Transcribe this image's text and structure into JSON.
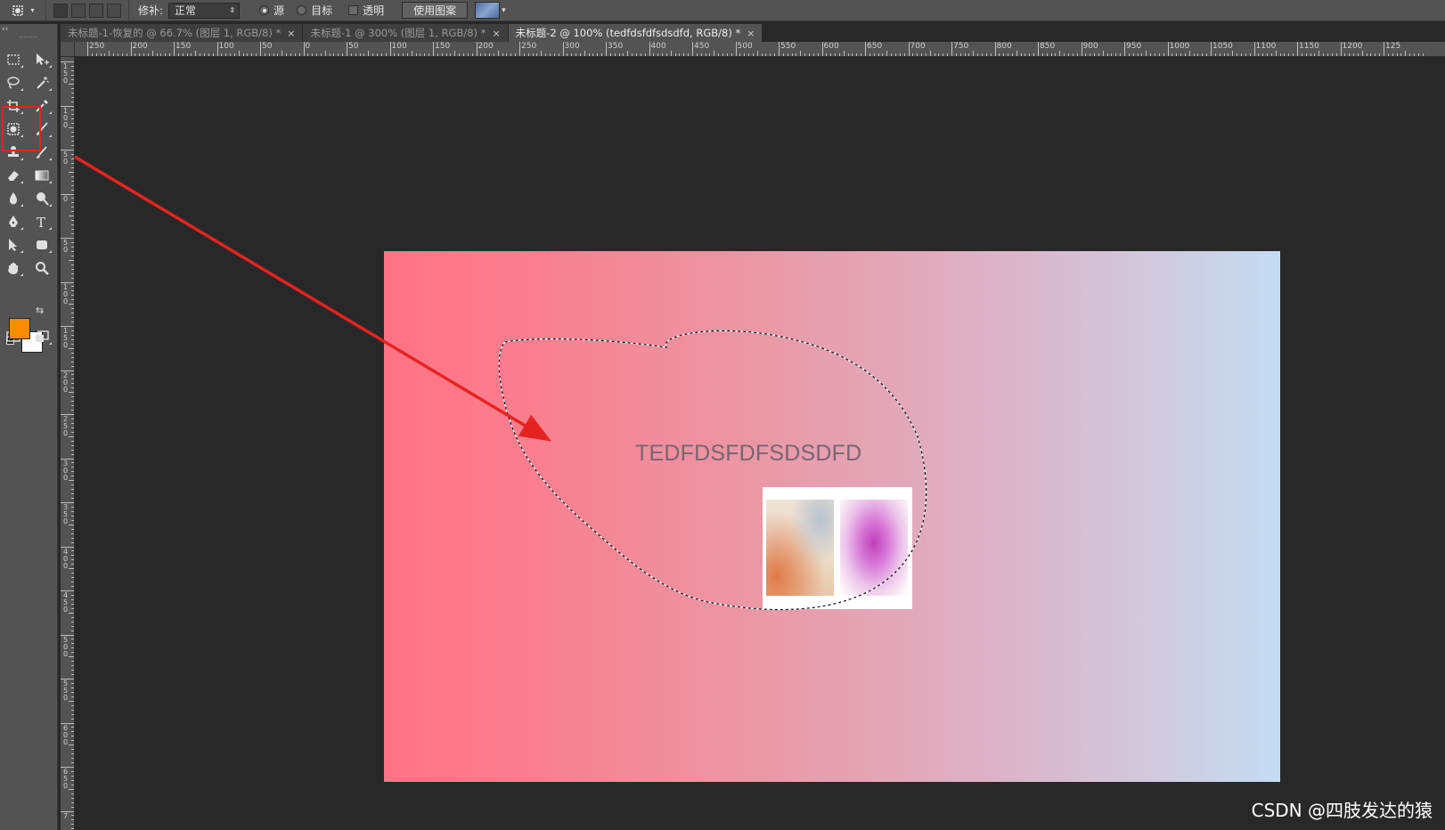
{
  "options_bar": {
    "tool_icon": "patch-tool-icon",
    "patch_label": "修补:",
    "patch_mode": "正常",
    "source_label": "源",
    "target_label": "目标",
    "transparent_label": "透明",
    "use_pattern_label": "使用图案",
    "source_selected": true,
    "transparent_checked": false
  },
  "tabs": [
    {
      "label": "未标题-1-恢复的 @ 66.7% (图层 1, RGB/8) *",
      "close": "×",
      "active": false
    },
    {
      "label": "未标题-1 @ 300% (图层 1, RGB/8) *",
      "close": "×",
      "active": false
    },
    {
      "label": "未标题-2 @ 100% (tedfdsfdfsdsdfd, RGB/8) *",
      "close": "×",
      "active": true
    }
  ],
  "toolbar": {
    "collapse_glyph": "‹‹",
    "tools": [
      "rectangular-marquee-tool",
      "move-tool",
      "lasso-tool",
      "magic-wand-tool",
      "crop-tool",
      "eyedropper-tool",
      "patch-tool",
      "brush-tool",
      "clone-stamp-tool",
      "history-brush-tool",
      "eraser-tool",
      "gradient-tool",
      "blur-tool",
      "dodge-tool",
      "pen-tool",
      "type-tool",
      "path-selection-tool",
      "rectangle-tool",
      "hand-tool",
      "zoom-tool",
      "quick-mask-icon",
      "screen-mode-icon"
    ],
    "foreground_color": "#ff8c00",
    "background_color": "#ffffff",
    "highlighted_tool": "patch-tool"
  },
  "ruler_top": [
    "250",
    "200",
    "150",
    "100",
    "50",
    "0",
    "50",
    "100",
    "150",
    "200",
    "250",
    "300",
    "350",
    "400",
    "450",
    "500",
    "550",
    "600",
    "650",
    "700",
    "750",
    "800",
    "850",
    "900",
    "950",
    "1000",
    "1050",
    "1100",
    "1150",
    "1200",
    "125"
  ],
  "ruler_left": [
    "150",
    "100",
    "50",
    "0",
    "50",
    "100",
    "150",
    "200",
    "250",
    "300",
    "350",
    "400",
    "450",
    "500",
    "550",
    "600",
    "650",
    "7"
  ],
  "document": {
    "text_layer": "TEDFDSFDFSDSDFD",
    "gradient_start": "#ff7285",
    "gradient_end": "#c4dcf3"
  },
  "annotation": {
    "arrow_color": "#e52421"
  },
  "watermark": "CSDN @四肢发达的猿"
}
